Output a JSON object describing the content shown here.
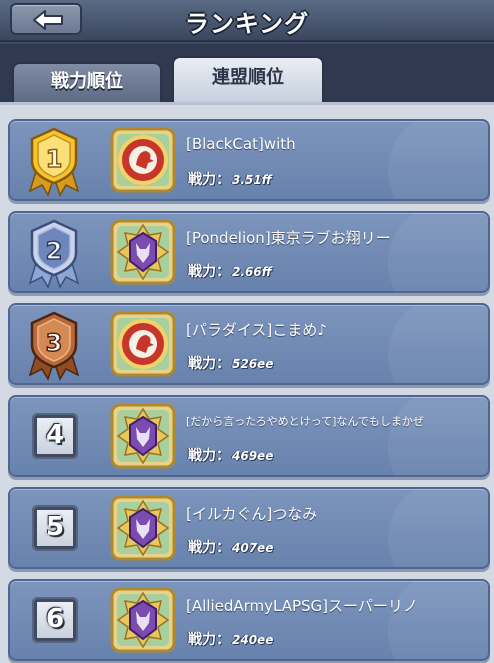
{
  "header": {
    "title": "ランキング",
    "back_icon": "back-arrow-icon"
  },
  "tabs": [
    {
      "label": "戦力順位",
      "active": false
    },
    {
      "label": "連盟順位",
      "active": true
    }
  ],
  "power_label": "戦力：",
  "rows": [
    {
      "rank": "1",
      "rank_style": "gold-medal",
      "emblem": "red-lion-emblem",
      "name": "[BlackCat]with",
      "power": "3.51ff"
    },
    {
      "rank": "2",
      "rank_style": "silver-medal",
      "emblem": "purple-wolf-emblem",
      "name": "[Pondelion]東京ラブお翔リー",
      "power": "2.66ff"
    },
    {
      "rank": "3",
      "rank_style": "bronze-medal",
      "emblem": "red-lion-emblem",
      "name": "[パラダイス]こまめ♪",
      "power": "526ee"
    },
    {
      "rank": "4",
      "rank_style": "box",
      "emblem": "purple-wolf-emblem",
      "name": "[だから言ったろやめとけって]なんでもしまかぜ",
      "power": "469ee"
    },
    {
      "rank": "5",
      "rank_style": "box",
      "emblem": "purple-wolf-emblem",
      "name": "[イルカぐん]つなみ",
      "power": "407ee"
    },
    {
      "rank": "6",
      "rank_style": "box",
      "emblem": "purple-wolf-emblem",
      "name": "[AlliedArmyLAPSG]スーパーリノ",
      "power": "240ee"
    }
  ],
  "colors": {
    "row_bg": "#7189b3",
    "gold": "#f2c230",
    "silver": "#c9d3ea",
    "bronze": "#b8683a",
    "emblem_frame": "#f0c63a",
    "lion_red": "#c8352a",
    "wolf_purple": "#7b4bb0"
  }
}
